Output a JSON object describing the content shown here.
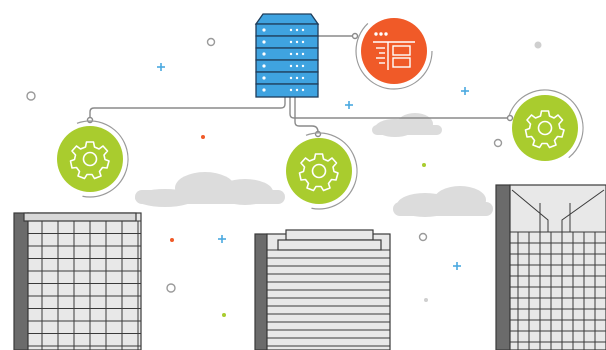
{
  "illustration": {
    "hub": {
      "icon": "server-rack-icon",
      "color": "#3fa3e0"
    },
    "dashboard": {
      "icon": "dashboard-layout-icon",
      "color": "#f05a28"
    },
    "nodes": [
      {
        "icon": "gear-icon",
        "color": "#a9cc2e"
      },
      {
        "icon": "gear-icon",
        "color": "#a9cc2e"
      },
      {
        "icon": "gear-icon",
        "color": "#a9cc2e"
      }
    ],
    "buildings": [
      {
        "icon": "office-building-icon"
      },
      {
        "icon": "office-building-icon"
      },
      {
        "icon": "office-building-icon"
      }
    ],
    "palette": {
      "building_fill": "#e8e8e8",
      "building_dark": "#6b6b6b",
      "line": "#8a8a8a",
      "cloud": "#dcdcdc",
      "sparkle_blue": "#4aa8e0",
      "sparkle_orange": "#f05a28",
      "sparkle_green": "#a9cc2e"
    }
  }
}
